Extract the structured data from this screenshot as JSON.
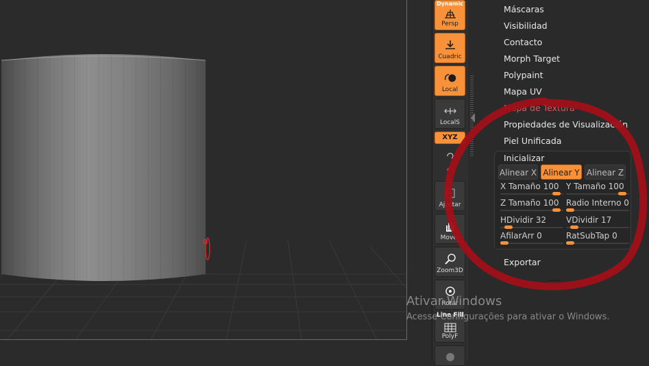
{
  "shelf": {
    "persp": {
      "top_label": "Dynamic",
      "label": "Persp"
    },
    "floor": {
      "label": "Cuadric"
    },
    "local": {
      "label": "Local"
    },
    "localsym": {
      "label": "LocalS"
    },
    "xyz": {
      "label": "XYZ"
    },
    "frame": {
      "label": "Ajustar"
    },
    "move": {
      "label": "Mover"
    },
    "zoom": {
      "label": "Zoom3D"
    },
    "rotate": {
      "label": "Rotar"
    },
    "linefill": {
      "top_label": "Line Fill",
      "label": "PolyF"
    }
  },
  "menu": {
    "items": [
      "Máscaras",
      "Visibilidad",
      "Contacto",
      "Morph Target",
      "Polypaint",
      "Mapa UV",
      "Mapa de Textura",
      "Propiedades de Visualización",
      "Piel Unificada"
    ],
    "subpanel": {
      "title": "Inicializar",
      "align_buttons": [
        "Alinear X",
        "Alinear Y",
        "Alinear Z"
      ],
      "active_align": "Alinear Y",
      "sliders": [
        {
          "label": "X Tamaño",
          "value": "100"
        },
        {
          "label": "Y Tamaño",
          "value": "100"
        },
        {
          "label": "Z Tamaño",
          "value": "100"
        },
        {
          "label": "Radio Interno",
          "value": "0"
        },
        {
          "label": "HDividir",
          "value": "32"
        },
        {
          "label": "VDividir",
          "value": "17"
        },
        {
          "label": "AfilarArr",
          "value": "0"
        },
        {
          "label": "RatSubTap",
          "value": "0"
        }
      ]
    },
    "export_label": "Exportar"
  },
  "watermark": {
    "title": "Ativar Windows",
    "subtitle": "Acesse Configurações para ativar o Windows."
  },
  "colors": {
    "accent": "#f7923a",
    "annotation": "#b3121c",
    "background": "#2a2a2a"
  }
}
